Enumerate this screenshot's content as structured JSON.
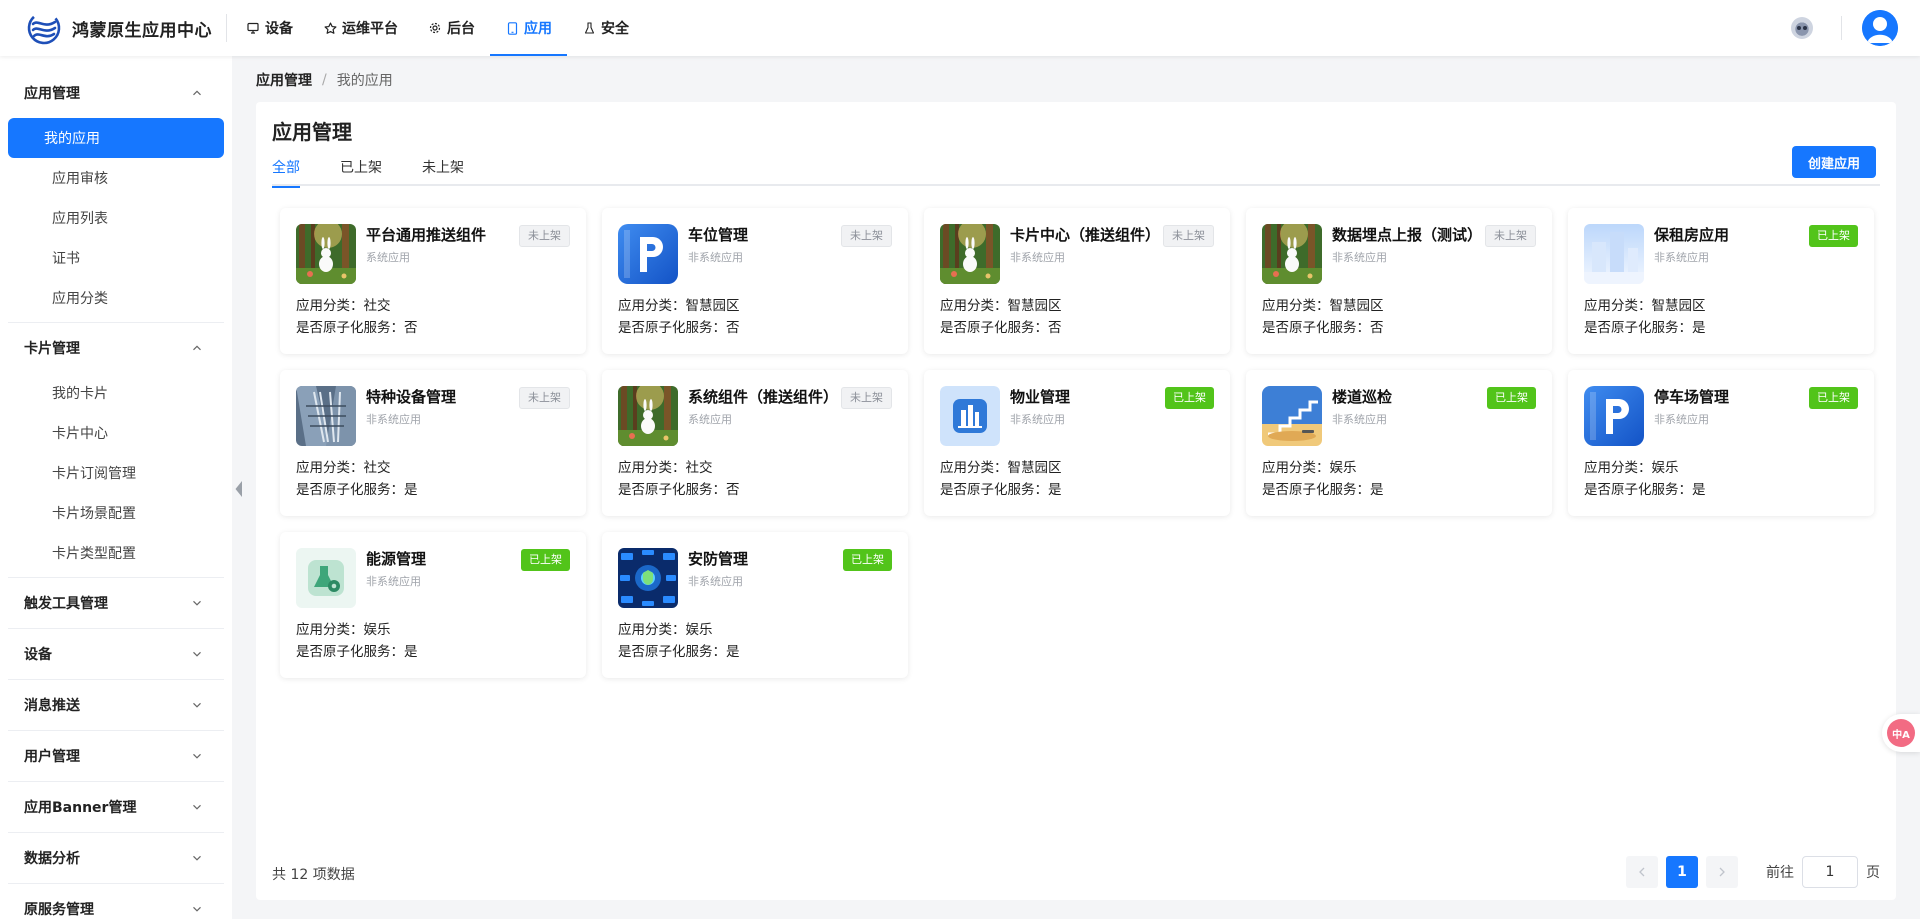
{
  "brand": {
    "title": "鸿蒙原生应用中心",
    "icon": "brand-logo-icon"
  },
  "topnav": [
    {
      "label": "设备",
      "icon": "monitor-icon",
      "active": false
    },
    {
      "label": "运维平台",
      "icon": "star-icon",
      "active": false
    },
    {
      "label": "后台",
      "icon": "gear-icon",
      "active": false
    },
    {
      "label": "应用",
      "icon": "phone-icon",
      "active": true
    },
    {
      "label": "安全",
      "icon": "flask-icon",
      "active": false
    }
  ],
  "sidebar": {
    "groups": [
      {
        "label": "应用管理",
        "expanded": true,
        "items": [
          "我的应用",
          "应用审核",
          "应用列表",
          "证书",
          "应用分类"
        ],
        "active_index": 0
      },
      {
        "label": "卡片管理",
        "expanded": true,
        "items": [
          "我的卡片",
          "卡片中心",
          "卡片订阅管理",
          "卡片场景配置",
          "卡片类型配置"
        ]
      },
      {
        "label": "触发工具管理",
        "expanded": false,
        "items": []
      },
      {
        "label": "设备",
        "expanded": false,
        "items": []
      },
      {
        "label": "消息推送",
        "expanded": false,
        "items": []
      },
      {
        "label": "用户管理",
        "expanded": false,
        "items": []
      },
      {
        "label": "应用Banner管理",
        "expanded": false,
        "items": []
      },
      {
        "label": "数据分析",
        "expanded": false,
        "items": []
      },
      {
        "label": "原服务管理",
        "expanded": false,
        "items": []
      }
    ]
  },
  "breadcrumb": {
    "root": "应用管理",
    "separator": "/",
    "current": "我的应用"
  },
  "main": {
    "title": "应用管理",
    "tabs": [
      "全部",
      "已上架",
      "未上架"
    ],
    "active_tab": 0,
    "create_label": "创建应用",
    "category_label": "应用分类：",
    "atomic_label": "是否原子化服务：",
    "cards": [
      {
        "name": "平台通用推送组件",
        "type": "系统应用",
        "status": "未上架",
        "status_kind": "off",
        "category": "社交",
        "atomic": "否",
        "icon": "rabbit-forest"
      },
      {
        "name": "车位管理",
        "type": "非系统应用",
        "status": "未上架",
        "status_kind": "off",
        "category": "智慧园区",
        "atomic": "否",
        "icon": "parking-p"
      },
      {
        "name": "卡片中心（推送组件）",
        "type": "非系统应用",
        "status": "未上架",
        "status_kind": "off",
        "category": "智慧园区",
        "atomic": "否",
        "icon": "rabbit-forest"
      },
      {
        "name": "数据埋点上报（测试）",
        "type": "非系统应用",
        "status": "未上架",
        "status_kind": "off",
        "category": "智慧园区",
        "atomic": "否",
        "icon": "rabbit-forest"
      },
      {
        "name": "保租房应用",
        "type": "非系统应用",
        "status": "已上架",
        "status_kind": "on",
        "category": "智慧园区",
        "atomic": "是",
        "icon": "building-light"
      },
      {
        "name": "特种设备管理",
        "type": "非系统应用",
        "status": "未上架",
        "status_kind": "off",
        "category": "社交",
        "atomic": "是",
        "icon": "escalator"
      },
      {
        "name": "系统组件（推送组件）",
        "type": "系统应用",
        "status": "未上架",
        "status_kind": "off",
        "category": "社交",
        "atomic": "否",
        "icon": "rabbit-forest"
      },
      {
        "name": "物业管理",
        "type": "非系统应用",
        "status": "已上架",
        "status_kind": "on",
        "category": "智慧园区",
        "atomic": "是",
        "icon": "property-building"
      },
      {
        "name": "楼道巡检",
        "type": "非系统应用",
        "status": "已上架",
        "status_kind": "on",
        "category": "娱乐",
        "atomic": "是",
        "icon": "stairs"
      },
      {
        "name": "停车场管理",
        "type": "非系统应用",
        "status": "已上架",
        "status_kind": "on",
        "category": "娱乐",
        "atomic": "是",
        "icon": "parking-p"
      },
      {
        "name": "能源管理",
        "type": "非系统应用",
        "status": "已上架",
        "status_kind": "on",
        "category": "娱乐",
        "atomic": "是",
        "icon": "energy-flask"
      },
      {
        "name": "安防管理",
        "type": "非系统应用",
        "status": "已上架",
        "status_kind": "on",
        "category": "娱乐",
        "atomic": "是",
        "icon": "security-network"
      }
    ]
  },
  "pagination": {
    "total_text": "共 12 项数据",
    "current_page": "1",
    "goto_prefix": "前往",
    "goto_value": "1",
    "goto_suffix": "页"
  },
  "colors": {
    "accent": "#1677ff",
    "published": "#52c41a"
  }
}
